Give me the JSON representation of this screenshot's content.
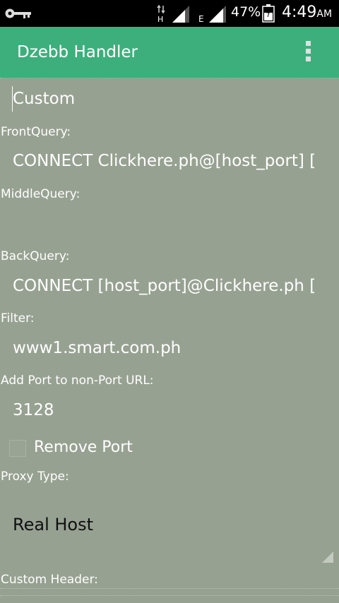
{
  "status_bar": {
    "network_type_1": "H",
    "network_type_2": "E",
    "battery_percent": "47%",
    "time": "4:49",
    "ampm": "AM"
  },
  "action_bar": {
    "title": "Dzebb Handler",
    "menu_icon": "overflow-menu-icon"
  },
  "form": {
    "preset_value": "Custom",
    "front_query_label": "FrontQuery:",
    "front_query_value": "CONNECT Clickhere.ph@[host_port] [",
    "middle_query_label": "MiddleQuery:",
    "middle_query_value": "",
    "back_query_label": "BackQuery:",
    "back_query_value": "CONNECT [host_port]@Clickhere.ph [",
    "filter_label": "Filter:",
    "filter_value": "www1.smart.com.ph",
    "add_port_label": "Add Port to non-Port URL:",
    "add_port_value": "3128",
    "remove_port_label": "Remove Port",
    "remove_port_checked": false,
    "proxy_type_label": "Proxy Type:",
    "proxy_type_value": "Real Host",
    "custom_header_label": "Custom Header:"
  },
  "colors": {
    "accent": "#3daf7c",
    "background": "#97a191"
  }
}
